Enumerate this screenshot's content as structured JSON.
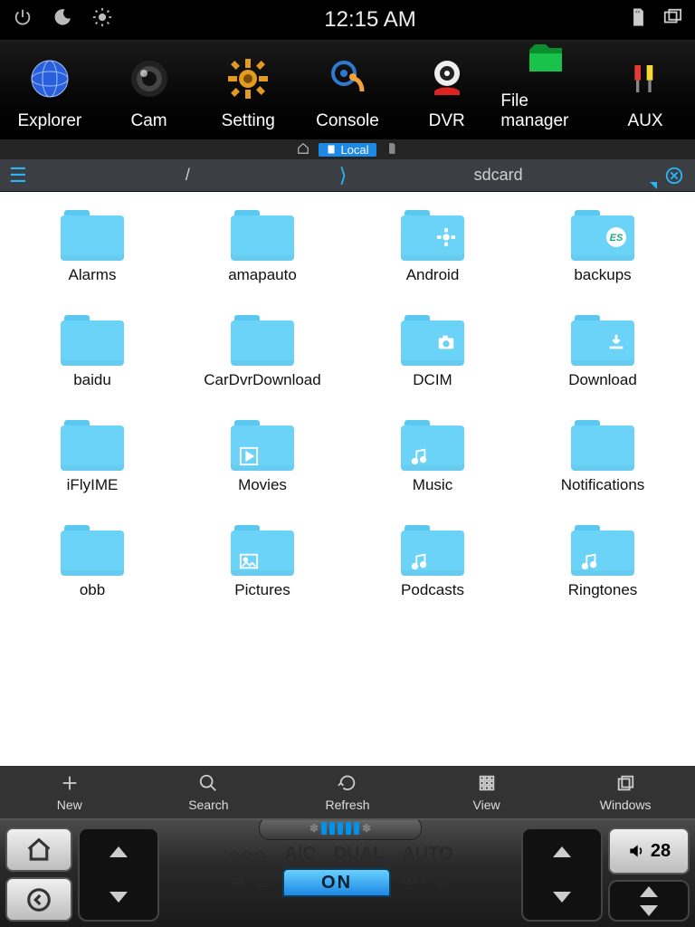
{
  "status": {
    "time": "12:15 AM"
  },
  "dock": [
    {
      "label": "Explorer"
    },
    {
      "label": "Cam"
    },
    {
      "label": "Setting"
    },
    {
      "label": "Console"
    },
    {
      "label": "DVR"
    },
    {
      "label": "File manager"
    },
    {
      "label": "AUX"
    }
  ],
  "storage": {
    "localTab": "Local"
  },
  "path": {
    "root": "/",
    "current": "sdcard"
  },
  "files": [
    {
      "name": "Alarms",
      "badge": null
    },
    {
      "name": "amapauto",
      "badge": null
    },
    {
      "name": "Android",
      "badge": "gear"
    },
    {
      "name": "backups",
      "badge": "es"
    },
    {
      "name": "baidu",
      "badge": null
    },
    {
      "name": "CarDvrDownload",
      "badge": null
    },
    {
      "name": "DCIM",
      "badge": "camera"
    },
    {
      "name": "Download",
      "badge": "download"
    },
    {
      "name": "iFlyIME",
      "badge": null
    },
    {
      "name": "Movies",
      "badge": "play",
      "bl": true
    },
    {
      "name": "Music",
      "badge": "music",
      "bl": true
    },
    {
      "name": "Notifications",
      "badge": null
    },
    {
      "name": "obb",
      "badge": null
    },
    {
      "name": "Pictures",
      "badge": "picture",
      "bl": true
    },
    {
      "name": "Podcasts",
      "badge": "music",
      "bl": true
    },
    {
      "name": "Ringtones",
      "badge": "music",
      "bl": true
    }
  ],
  "toolbar": [
    {
      "label": "New",
      "icon": "plus"
    },
    {
      "label": "Search",
      "icon": "search"
    },
    {
      "label": "Refresh",
      "icon": "refresh"
    },
    {
      "label": "View",
      "icon": "grid"
    },
    {
      "label": "Windows",
      "icon": "windows"
    }
  ],
  "climate": {
    "ac": "A/C",
    "dual": "DUAL",
    "auto": "AUTO",
    "on": "ON"
  },
  "volume": {
    "level": "28"
  }
}
